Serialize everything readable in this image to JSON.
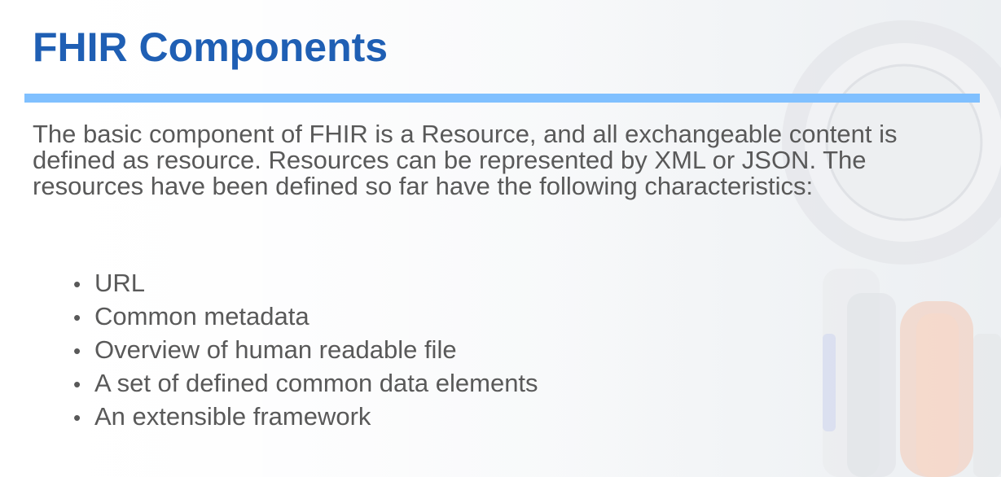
{
  "slide": {
    "title": "FHIR Components",
    "intro": "The basic component of FHIR is a Resource, and all exchangeable content is defined as resource. Resources can be represented by XML or JSON. The resources have been defined so far have the following characteristics:",
    "bullets": [
      "URL",
      "Common metadata",
      "Overview of human readable file",
      "A set of defined common data elements",
      "An extensible framework"
    ],
    "bullet_glyph": "•"
  },
  "colors": {
    "title": "#1f5fb4",
    "rule": "#80c0ff",
    "body_text": "#595959"
  },
  "background": {
    "icon": "stethoscope-photo"
  }
}
